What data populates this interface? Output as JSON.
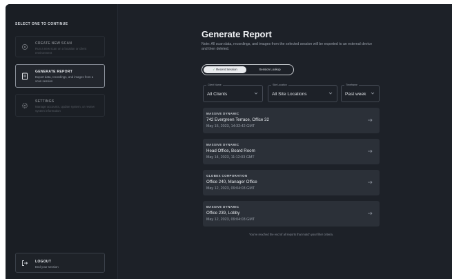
{
  "sidebar": {
    "heading": "SELECT ONE TO CONTINUE",
    "options": [
      {
        "title": "CREATE NEW SCAN",
        "subtitle": "Run a new scan on a location or client environment",
        "icon": "scan-icon"
      },
      {
        "title": "GENERATE REPORT",
        "subtitle": "Export data, recordings, and images from a scan session",
        "icon": "report-icon"
      },
      {
        "title": "SETTINGS",
        "subtitle": "Manage accounts, update system, or review system information",
        "icon": "gear-icon"
      }
    ],
    "logout": {
      "title": "LOGOUT",
      "subtitle": "End your session",
      "icon": "logout-icon"
    }
  },
  "main": {
    "title": "Generate Report",
    "description": "Note: All scan data, recordings, and images from the selected session will be exported to an external device and then deleted.",
    "toggle": {
      "options": [
        "Recent Session",
        "Session Lookup"
      ],
      "active": "Recent Session",
      "check_icon": "check-icon"
    },
    "filters": [
      {
        "label": "Client Name",
        "value": "All Clients"
      },
      {
        "label": "Site Location",
        "value": "All Site Locations"
      },
      {
        "label": "Timeframe",
        "value": "Past week"
      }
    ],
    "sessions": [
      {
        "client": "MASSIVE DYNAMIC",
        "location": "742 Evergreen Terrace, Office 32",
        "timestamp": "May 15, 2023, 14:32:42 GMT"
      },
      {
        "client": "MASSIVE DYNAMIC",
        "location": "Head Office, Board Room",
        "timestamp": "May 14, 2023, 11:12:03 GMT"
      },
      {
        "client": "GLOBEX CORPORATION",
        "location": "Office 240, Manager Office",
        "timestamp": "May 12, 2023, 09:04:03 GMT"
      },
      {
        "client": "MASSIVE DYNAMIC",
        "location": "Office 239, Lobby",
        "timestamp": "May 12, 2023, 09:04:03 GMT"
      }
    ],
    "end_note": "You've reached the end of all reports that match your filter criteria."
  },
  "colors": {
    "background": "#1d2128",
    "sidebar": "#1a1e24",
    "card": "#2b3038",
    "accent_border": "#8a909a"
  }
}
